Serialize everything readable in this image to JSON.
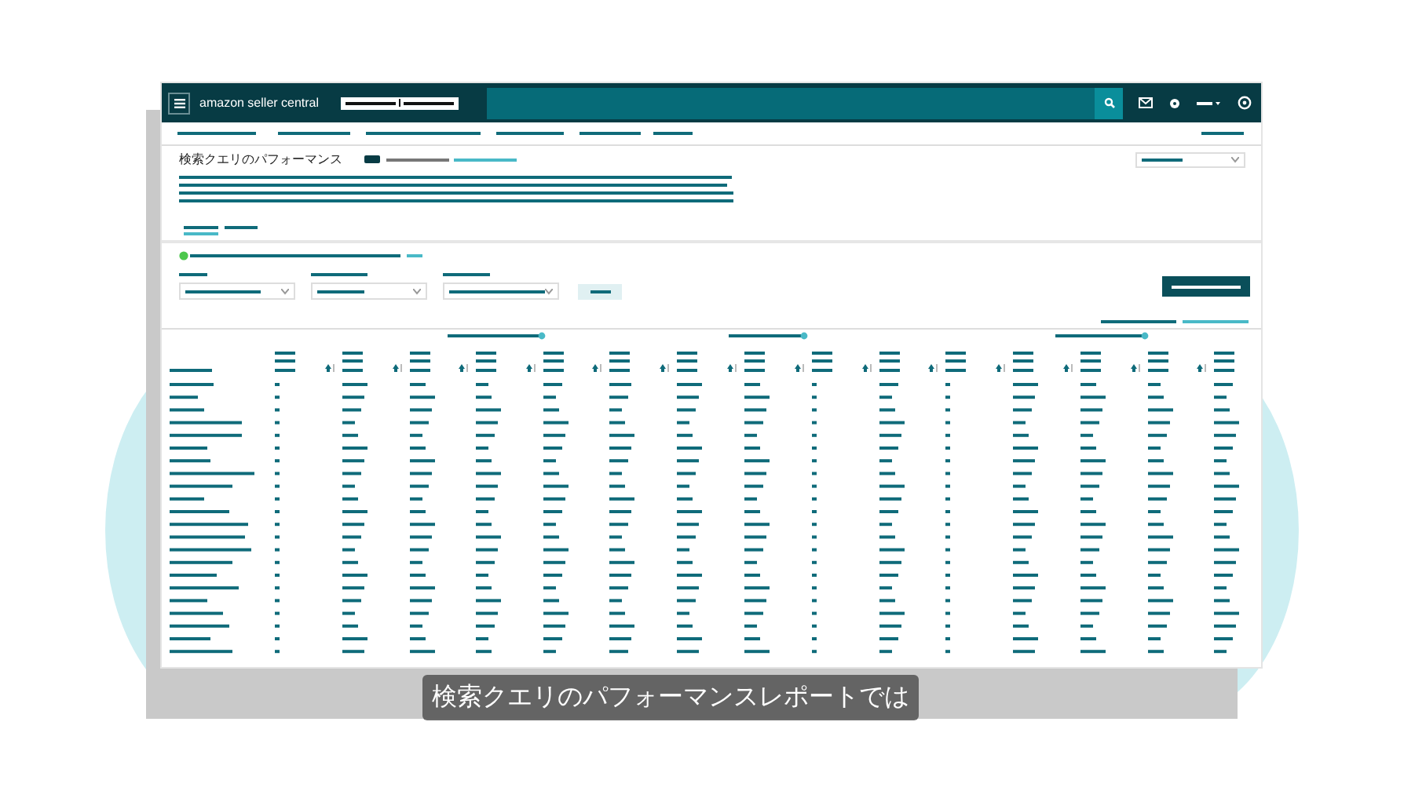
{
  "header": {
    "logo": "amazon seller central"
  },
  "page": {
    "title": "検索クエリのパフォーマンス"
  },
  "caption": "検索クエリのパフォーマンスレポートでは"
}
